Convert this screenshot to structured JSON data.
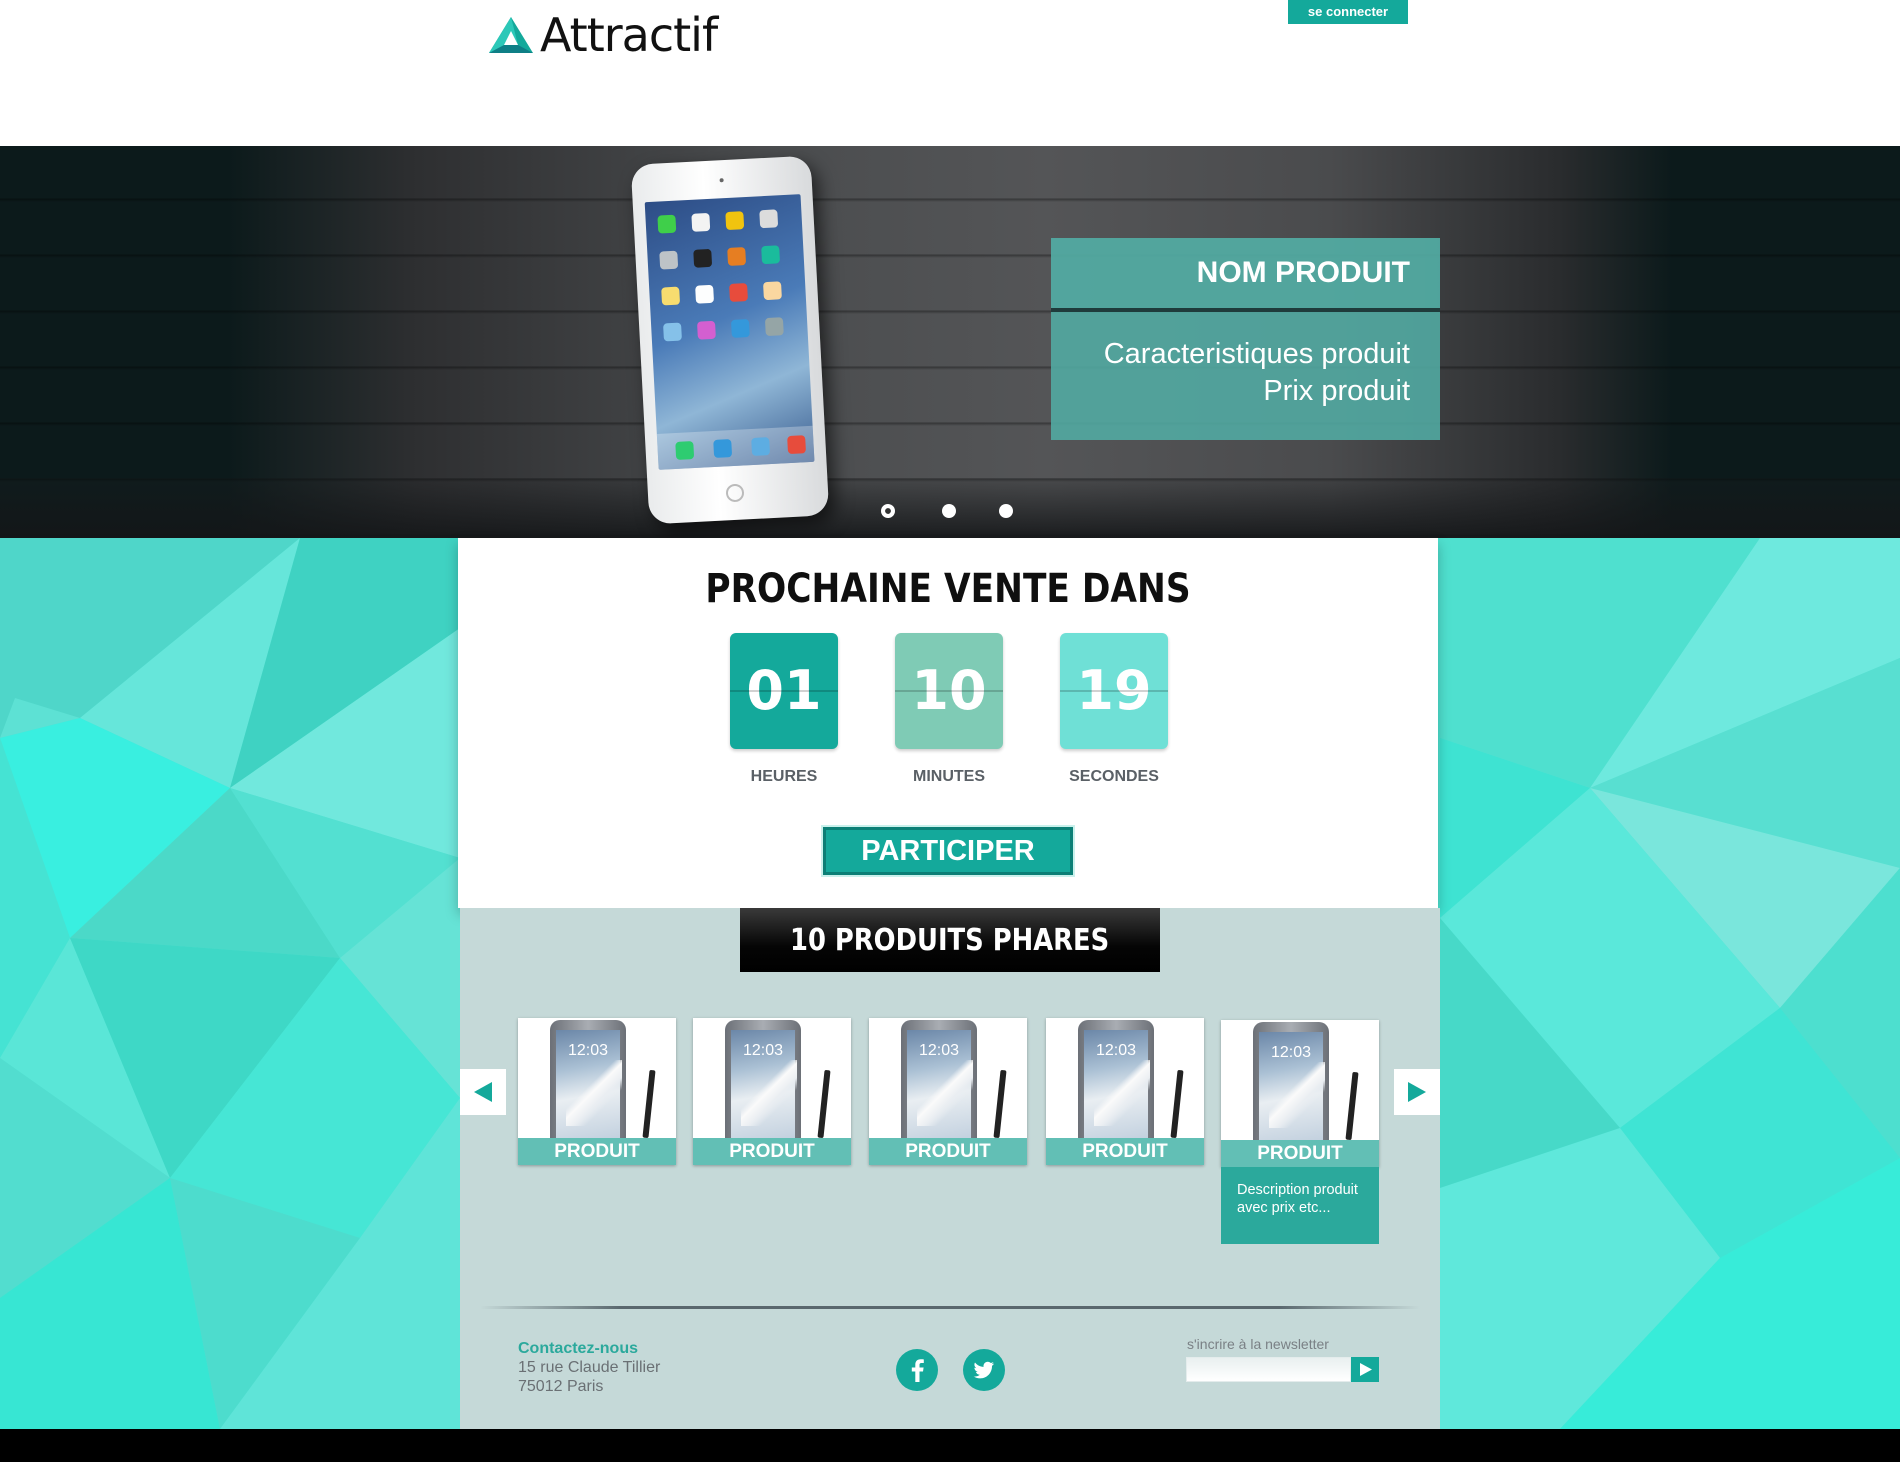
{
  "header": {
    "logo_text": "Attractif",
    "login_label": "se connecter"
  },
  "hero": {
    "product_name": "NOM PRODUIT",
    "product_features": "Caracteristiques produit",
    "product_price": "Prix produit",
    "slide_count": 3,
    "active_slide": 1
  },
  "countdown": {
    "title": "PROCHAINE VENTE DANS",
    "hours": {
      "value": "01",
      "label": "HEURES",
      "color": "#14a99b"
    },
    "minutes": {
      "value": "10",
      "label": "MINUTES",
      "color": "#7fcbb5"
    },
    "seconds": {
      "value": "19",
      "label": "SECONDES",
      "color": "#6fe0d6"
    },
    "cta_label": "PARTICIPER"
  },
  "products": {
    "title": "10 PRODUITS PHARES",
    "items": [
      {
        "time": "12:03",
        "label": "PRODUIT"
      },
      {
        "time": "12:03",
        "label": "PRODUIT"
      },
      {
        "time": "12:03",
        "label": "PRODUIT"
      },
      {
        "time": "12:03",
        "label": "PRODUIT"
      },
      {
        "time": "12:03",
        "label": "PRODUIT",
        "description": "Description produit avec prix etc..."
      }
    ]
  },
  "footer": {
    "contact_title": "Contactez-nous",
    "address_line1": "15 rue Claude Tillier",
    "address_line2": "75012 Paris",
    "social": [
      "facebook-icon",
      "twitter-icon"
    ],
    "newsletter_label": "s'incrire à la newsletter",
    "newsletter_value": ""
  },
  "colors": {
    "accent": "#14a99b",
    "background": "#4ee3d2",
    "panel": "#c5d9d8"
  }
}
